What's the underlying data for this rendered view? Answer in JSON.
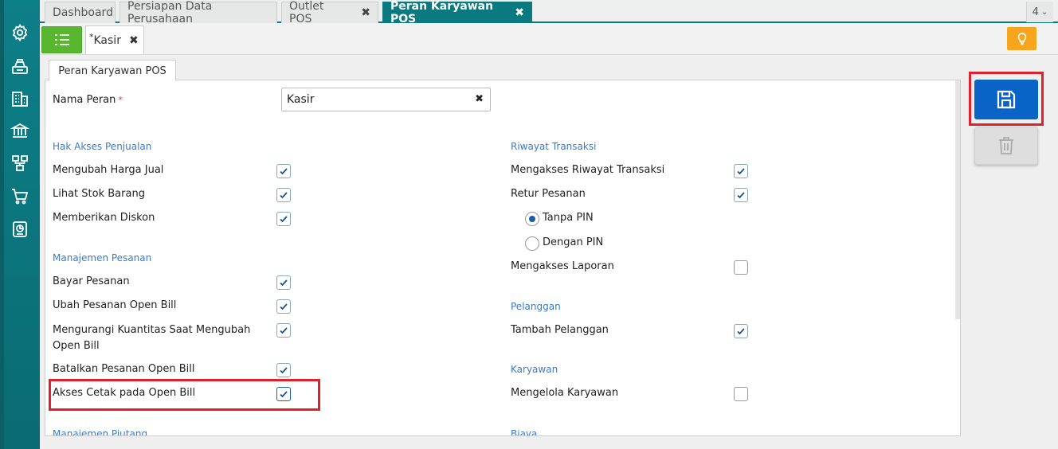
{
  "tabs": [
    {
      "label": "Dashboard",
      "closable": false,
      "active": false
    },
    {
      "label": "Persiapan Data Perusahaan",
      "closable": false,
      "active": false
    },
    {
      "label": "Outlet POS",
      "closable": true,
      "active": false
    },
    {
      "label": "Peran Karyawan POS",
      "closable": true,
      "active": true
    }
  ],
  "tab_count": "4",
  "subtab": {
    "modified_mark": "*",
    "label": "Kasir"
  },
  "form_tab": "Peran Karyawan POS",
  "form": {
    "role_name_label": "Nama Peran",
    "required_mark": "*",
    "role_name_value": "Kasir"
  },
  "left": {
    "sec_penjualan": "Hak Akses Penjualan",
    "ubah_harga": "Mengubah Harga Jual",
    "lihat_stok": "Lihat Stok Barang",
    "diskon": "Memberikan Diskon",
    "sec_pesanan": "Manajemen Pesanan",
    "bayar": "Bayar Pesanan",
    "ubah_open": "Ubah Pesanan Open Bill",
    "kurangi_qty": "Mengurangi Kuantitas Saat Mengubah Open Bill",
    "batalkan": "Batalkan Pesanan Open Bill",
    "cetak": "Akses Cetak pada Open Bill",
    "sec_piutang": "Manajemen Piutang"
  },
  "right": {
    "sec_riwayat": "Riwayat Transaksi",
    "akses_riwayat": "Mengakses Riwayat Transaksi",
    "retur": "Retur Pesanan",
    "tanpa_pin": "Tanpa PIN",
    "dengan_pin": "Dengan PIN",
    "laporan": "Mengakses Laporan",
    "sec_pelanggan": "Pelanggan",
    "tambah_pelanggan": "Tambah Pelanggan",
    "sec_karyawan": "Karyawan",
    "kelola_karyawan": "Mengelola Karyawan",
    "sec_biaya": "Biaya"
  },
  "checked": {
    "ubah_harga": true,
    "lihat_stok": true,
    "diskon": true,
    "bayar": true,
    "ubah_open": true,
    "kurangi_qty": true,
    "batalkan": true,
    "cetak": true,
    "akses_riwayat": true,
    "retur": true,
    "laporan": false,
    "tambah_pelanggan": true,
    "kelola_karyawan": false
  },
  "retur_pin_option": "Tanpa PIN",
  "icons": [
    "gear-icon",
    "cash-register-icon",
    "building-icon",
    "bank-icon",
    "network-icon",
    "cart-icon",
    "report-icon",
    "list-icon",
    "lightbulb-icon",
    "save-icon",
    "trash-icon",
    "close-icon",
    "chevron-down-icon",
    "check-icon"
  ],
  "colors": {
    "sidebar": "#0b7a80",
    "active_tab": "#0b7a80",
    "menu_button": "#59b62f",
    "save_button": "#0a63c6",
    "highlight": "#e0202a",
    "section_text": "#3a7bc8",
    "bulb_button": "#f7a51c"
  }
}
